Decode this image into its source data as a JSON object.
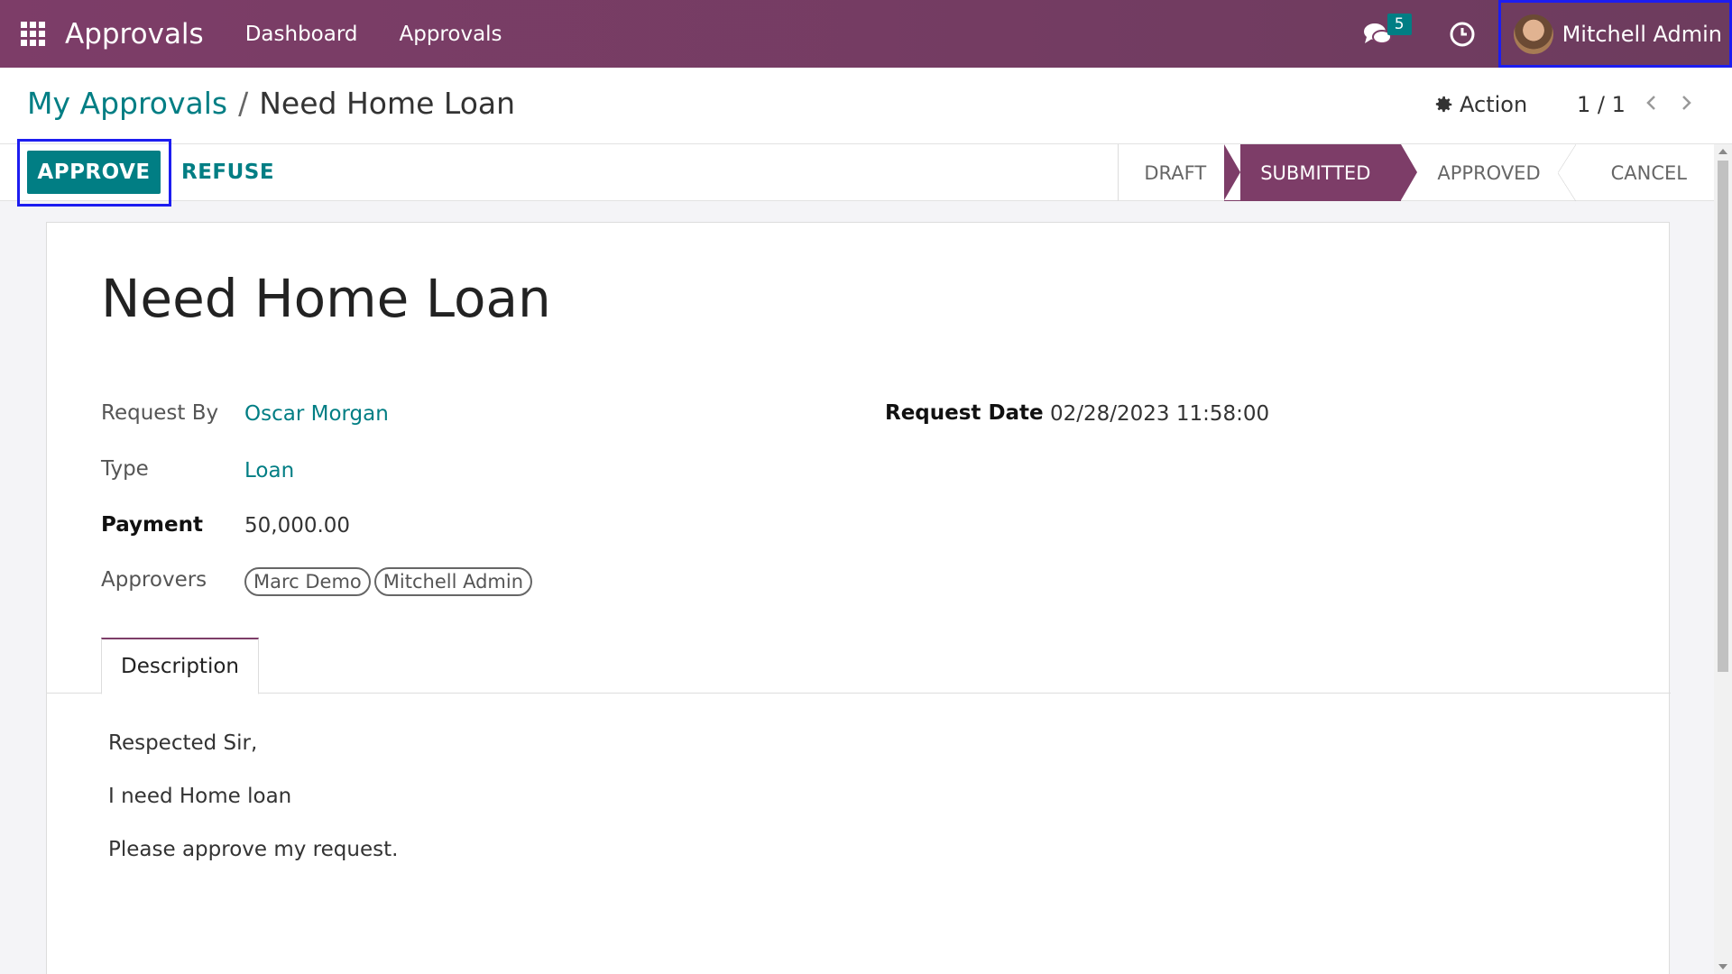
{
  "navbar": {
    "app_title": "Approvals",
    "menu": [
      "Dashboard",
      "Approvals"
    ],
    "chat_count": "5",
    "user_name": "Mitchell Admin",
    "icons": {
      "apps": "apps-grid-icon",
      "chat": "chat-icon",
      "activity": "clock-icon"
    }
  },
  "control_panel": {
    "breadcrumb_parent": "My Approvals",
    "breadcrumb_separator": "/",
    "breadcrumb_current": "Need Home Loan",
    "action_label": "Action",
    "pager": "1 / 1"
  },
  "statusbar": {
    "approve_label": "APPROVE",
    "refuse_label": "REFUSE",
    "stages": [
      "DRAFT",
      "SUBMITTED",
      "APPROVED",
      "CANCEL"
    ],
    "active_stage": "SUBMITTED"
  },
  "form": {
    "title": "Need Home Loan",
    "request_by_label": "Request By",
    "request_by": "Oscar Morgan",
    "type_label": "Type",
    "type": "Loan",
    "payment_label": "Payment",
    "payment": "50,000.00",
    "approvers_label": "Approvers",
    "approvers": [
      "Marc Demo",
      "Mitchell Admin"
    ],
    "request_date_label": "Request Date",
    "request_date": "02/28/2023 11:58:00",
    "tab_description": "Description",
    "description_lines": [
      "Respected Sir,",
      "I need Home loan",
      "Please approve my request."
    ]
  },
  "colors": {
    "brand": "#7d3d68",
    "accent": "#017e84"
  }
}
